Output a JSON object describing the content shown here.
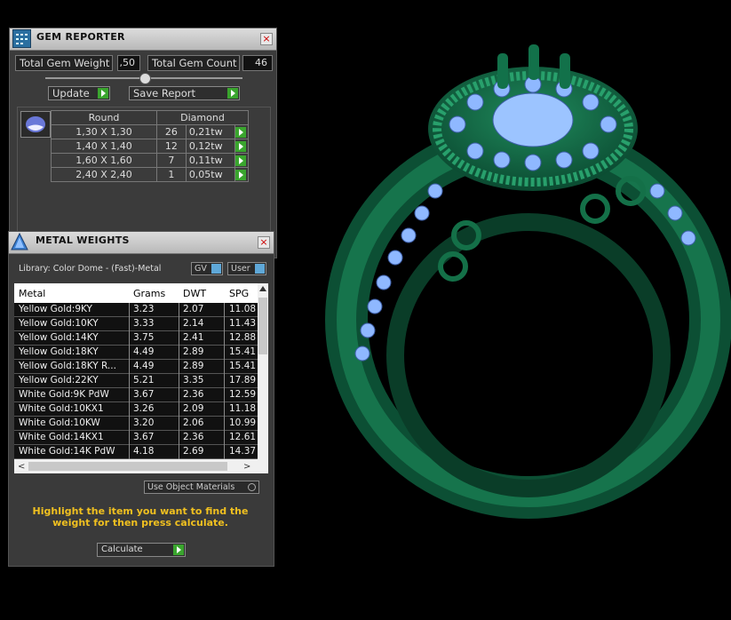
{
  "gem_reporter": {
    "title": "GEM REPORTER",
    "close": "×",
    "total_weight_label": "Total Gem Weight",
    "total_weight_value": ",50",
    "total_count_label": "Total Gem Count",
    "total_count_value": "46",
    "update_label": "Update",
    "save_label": "Save Report",
    "shape": "Round",
    "material": "Diamond",
    "rows": [
      {
        "size": "1,30 X 1,30",
        "count": "26",
        "tw": "0,21tw"
      },
      {
        "size": "1,40 X 1,40",
        "count": "12",
        "tw": "0,12tw"
      },
      {
        "size": "1,60 X 1,60",
        "count": "7",
        "tw": "0,11tw"
      },
      {
        "size": "2,40 X 2,40",
        "count": "1",
        "tw": "0,05tw"
      }
    ]
  },
  "metal_weights": {
    "title": "METAL WEIGHTS",
    "close": "×",
    "library": "Library: Color Dome - (Fast)-Metal",
    "gv_label": "GV",
    "user_label": "User",
    "columns": [
      "Metal",
      "Grams",
      "DWT",
      "SPG"
    ],
    "rows": [
      {
        "metal": "Yellow Gold:9KY",
        "grams": "3.23",
        "dwt": "2.07",
        "spg": "11.08"
      },
      {
        "metal": "Yellow Gold:10KY",
        "grams": "3.33",
        "dwt": "2.14",
        "spg": "11.43"
      },
      {
        "metal": "Yellow Gold:14KY",
        "grams": "3.75",
        "dwt": "2.41",
        "spg": "12.88"
      },
      {
        "metal": "Yellow Gold:18KY",
        "grams": "4.49",
        "dwt": "2.89",
        "spg": "15.41"
      },
      {
        "metal": "Yellow Gold:18KY R...",
        "grams": "4.49",
        "dwt": "2.89",
        "spg": "15.41"
      },
      {
        "metal": "Yellow Gold:22KY",
        "grams": "5.21",
        "dwt": "3.35",
        "spg": "17.89"
      },
      {
        "metal": "White Gold:9K PdW",
        "grams": "3.67",
        "dwt": "2.36",
        "spg": "12.59"
      },
      {
        "metal": "White Gold:10KX1",
        "grams": "3.26",
        "dwt": "2.09",
        "spg": "11.18"
      },
      {
        "metal": "White Gold:10KW",
        "grams": "3.20",
        "dwt": "2.06",
        "spg": "10.99"
      },
      {
        "metal": "White Gold:14KX1",
        "grams": "3.67",
        "dwt": "2.36",
        "spg": "12.61"
      },
      {
        "metal": "White Gold:14K PdW",
        "grams": "4.18",
        "dwt": "2.69",
        "spg": "14.37"
      }
    ],
    "use_object_materials": "Use Object Materials",
    "hint": "Highlight the item you want to find the weight for then press calculate.",
    "calculate_label": "Calculate"
  },
  "colors": {
    "accent_green": "#3aa52e",
    "hint_yellow": "#f0c020",
    "ring_green": "#0e5a3c",
    "gem_blue": "#8fb8ff"
  }
}
